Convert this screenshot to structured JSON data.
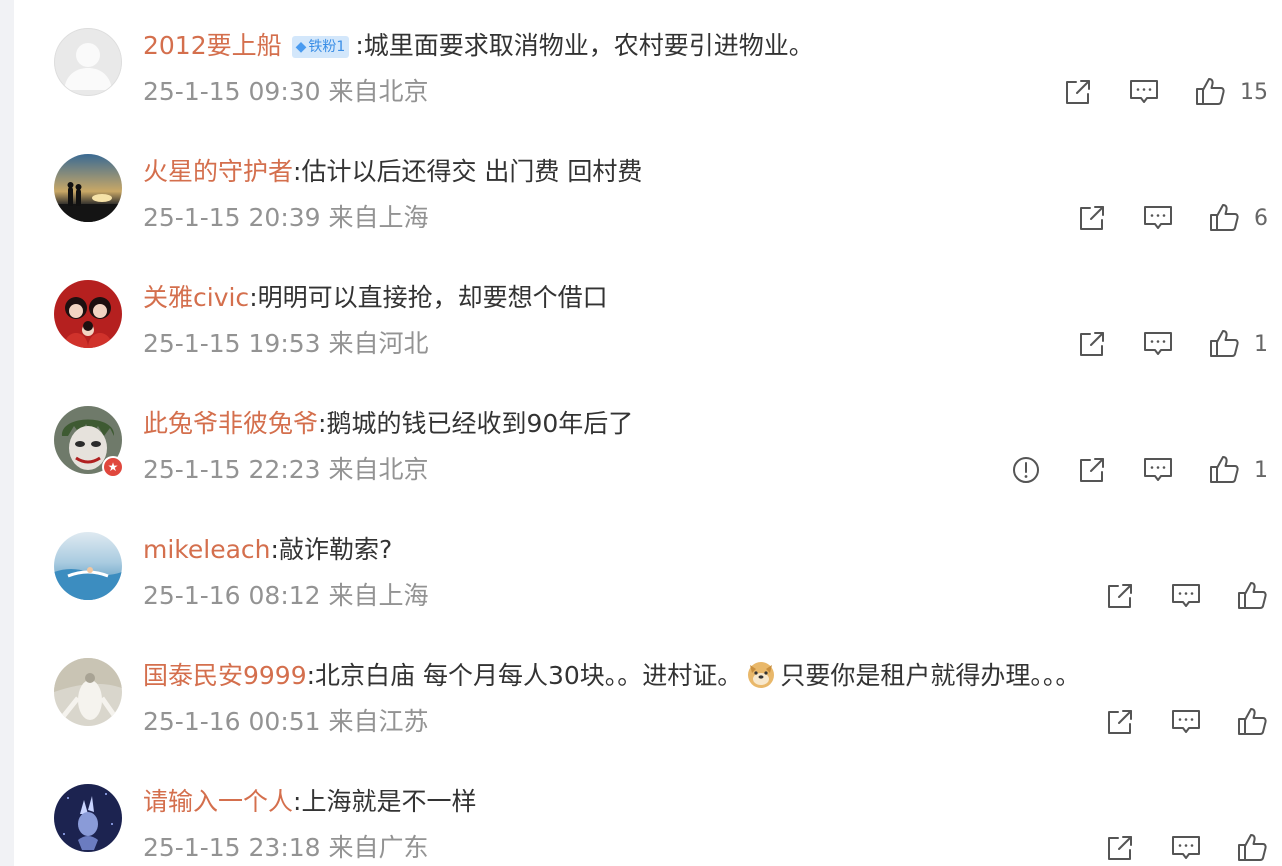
{
  "comments": [
    {
      "user": "2012要上船",
      "badge": "铁粉1",
      "text": ":城里面要求取消物业，农村要引进物业。",
      "time": "25-1-15 09:30",
      "location": "来自北京",
      "likes": "15",
      "report": false
    },
    {
      "user": "火星的守护者",
      "text": ":估计以后还得交  出门费 回村费",
      "time": "25-1-15 20:39",
      "location": "来自上海",
      "likes": "6",
      "report": false
    },
    {
      "user": "关雅civic",
      "text": ":明明可以直接抢，却要想个借口",
      "time": "25-1-15 19:53",
      "location": "来自河北",
      "likes": "1",
      "report": false
    },
    {
      "user": "此兔爷非彼兔爷",
      "text": ":鹅城的钱已经收到90年后了",
      "time": "25-1-15 22:23",
      "location": "来自北京",
      "likes": "1",
      "report": true
    },
    {
      "user": "mikeleach",
      "text": ":敲诈勒索?",
      "time": "25-1-16 08:12",
      "location": "来自上海",
      "likes": "",
      "report": false
    },
    {
      "user": "国泰民安9999",
      "text": ":北京白庙 每个月每人30块。。进村证。",
      "text_after_emoji": "只要你是租户就得办理。。。",
      "time": "25-1-16 00:51",
      "location": "来自江苏",
      "likes": "",
      "report": false
    },
    {
      "user": "请输入一个人",
      "text": ":上海就是不一样",
      "time": "25-1-15 23:18",
      "location": "来自广东",
      "likes": "",
      "report": false
    }
  ],
  "icons": {
    "report": "exclamation-circle-icon",
    "share": "share-external-icon",
    "comment": "comment-bubble-icon",
    "like": "thumbs-up-icon"
  },
  "colors": {
    "username": "#d46f4d",
    "meta": "#939393",
    "text": "#333333",
    "icon": "#555555",
    "badge_bg": "#d3e7fb",
    "badge_text": "#3a8ee6"
  }
}
